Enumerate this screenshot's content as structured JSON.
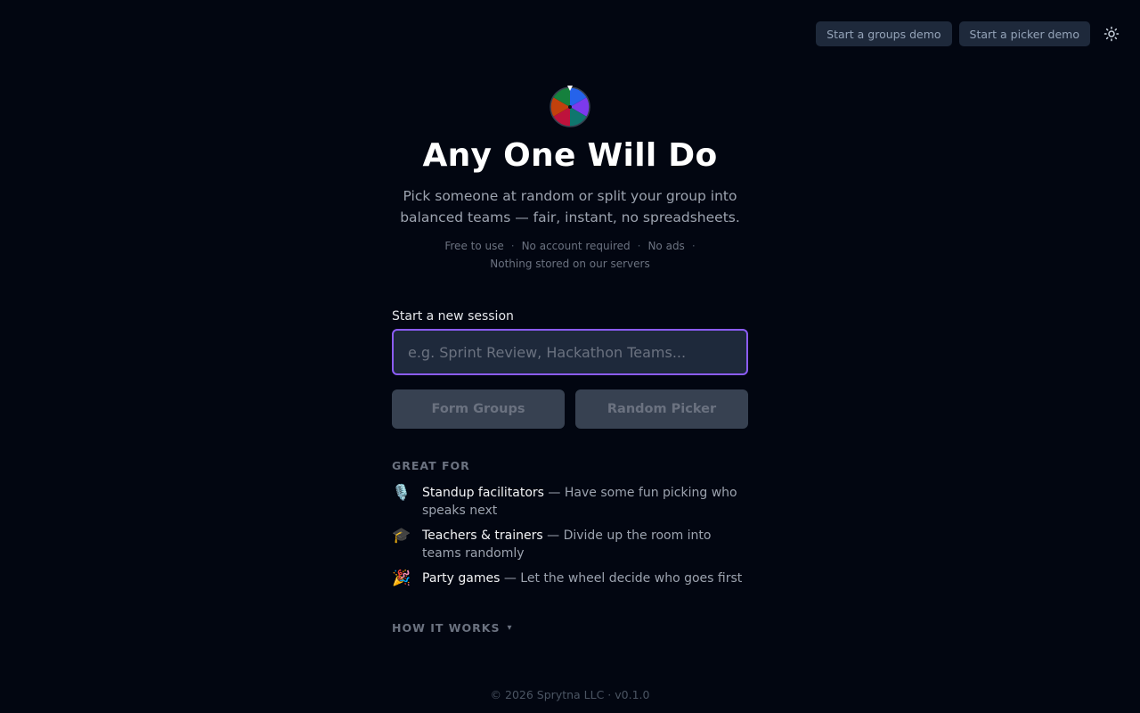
{
  "header": {
    "groups_demo_label": "Start a groups demo",
    "picker_demo_label": "Start a picker demo",
    "theme_icon": "sun-icon"
  },
  "hero": {
    "logo_icon": "wheel-logo-icon",
    "title": "Any One Will Do",
    "subtitle": "Pick someone at random or split your group into balanced teams — fair, instant, no spreadsheets.",
    "features": [
      "Free to use",
      "No account required",
      "No ads",
      "Nothing stored on our servers"
    ],
    "separator": "·"
  },
  "session": {
    "label": "Start a new session",
    "placeholder": "e.g. Sprint Review, Hackathon Teams...",
    "value": "",
    "form_groups_label": "Form Groups",
    "random_picker_label": "Random Picker"
  },
  "great_for": {
    "heading": "GREAT FOR",
    "items": [
      {
        "emoji": "🎙️",
        "icon": "microphone-icon",
        "title": "Standup facilitators",
        "desc": " — Have some fun picking who speaks next"
      },
      {
        "emoji": "🎓",
        "icon": "graduation-cap-icon",
        "title": "Teachers & trainers",
        "desc": " — Divide up the room into teams randomly"
      },
      {
        "emoji": "🎉",
        "icon": "party-popper-icon",
        "title": "Party games",
        "desc": " — Let the wheel decide who goes first"
      }
    ]
  },
  "how_it_works": {
    "label": "HOW IT WORKS",
    "caret": "▾"
  },
  "footer": {
    "text": "© 2026 Sprytna LLC · v0.1.0"
  },
  "colors": {
    "background": "#020611",
    "accent": "#8b5cf6",
    "button_bg": "#374151",
    "wheel_slices": [
      "#2563eb",
      "#7c3aed",
      "#0f766e",
      "#be123c",
      "#c2410c",
      "#15803d"
    ]
  }
}
